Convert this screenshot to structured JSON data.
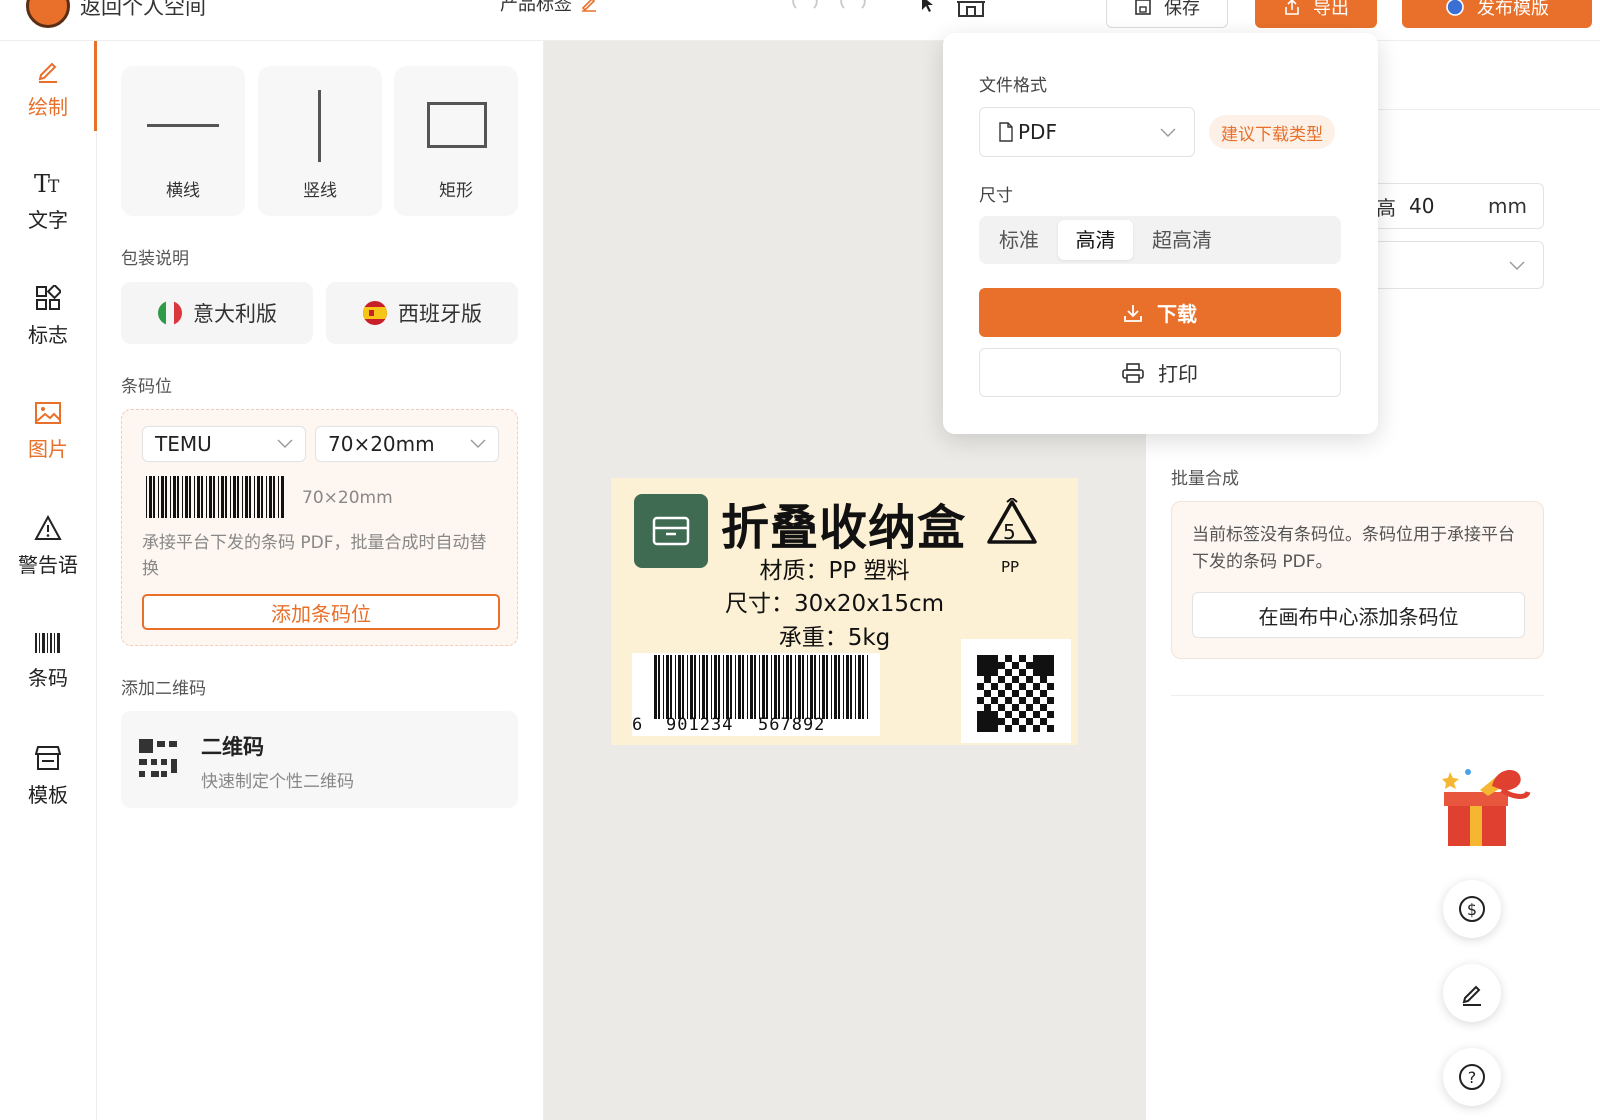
{
  "topbar": {
    "back_label": "返回个人空间",
    "doc_title": "产品标签",
    "save_label": "保存",
    "export_label": "导出",
    "publish_label": "发布模版"
  },
  "rail": {
    "items": [
      {
        "label": "绘制",
        "icon": "pencil-icon"
      },
      {
        "label": "文字",
        "icon": "text-size-icon"
      },
      {
        "label": "标志",
        "icon": "grid-shapes-icon"
      },
      {
        "label": "图片",
        "icon": "image-icon"
      },
      {
        "label": "警告语",
        "icon": "warning-icon"
      },
      {
        "label": "条码",
        "icon": "barcode-icon"
      },
      {
        "label": "模板",
        "icon": "store-icon"
      }
    ]
  },
  "left": {
    "shapes": [
      "横线",
      "竖线",
      "矩形"
    ],
    "packaging_title": "包装说明",
    "italy_label": "意大利版",
    "spain_label": "西班牙版",
    "barcode_title": "条码位",
    "platform_value": "TEMU",
    "size_value": "70×20mm",
    "barcode_size_caption": "70×20mm",
    "barcode_desc": "承接平台下发的条码 PDF，批量合成时自动替换",
    "add_barcode_button": "添加条码位",
    "qr_title": "添加二维码",
    "qr_card_title": "二维码",
    "qr_card_desc": "快速制定个性二维码"
  },
  "label": {
    "title": "折叠收纳盒",
    "material": "材质：PP 塑料",
    "size": "尺寸：30x20x15cm",
    "weight": "承重：5kg",
    "recycle_number": "5",
    "recycle_text": "PP",
    "barcode_digits": [
      "6",
      "901234",
      "567892"
    ]
  },
  "right": {
    "height_label": "高",
    "height_value": "40",
    "height_unit": "mm",
    "batch_title": "批量合成",
    "batch_desc": "当前标签没有条码位。条码位用于承接平台下发的条码 PDF。",
    "batch_button": "在画布中心添加条码位"
  },
  "popover": {
    "format_label": "文件格式",
    "format_value": "PDF",
    "suggest_badge": "建议下载类型",
    "size_label": "尺寸",
    "size_options": [
      "标准",
      "高清",
      "超高清"
    ],
    "selected_size": "高清",
    "download_button": "下载",
    "print_button": "打印"
  },
  "colors": {
    "accent": "#E8702A",
    "label_bg": "#FDF1D5",
    "label_icon": "#3F6B52"
  }
}
